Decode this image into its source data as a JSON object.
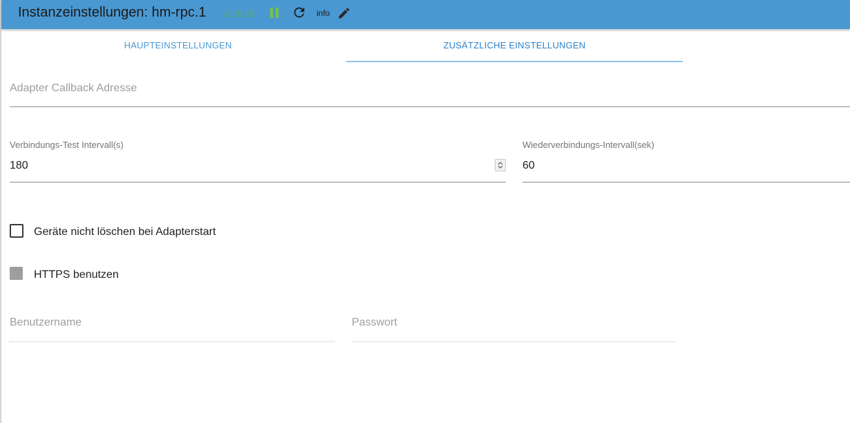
{
  "header": {
    "title": "Instanzeinstellungen: hm-rpc.1",
    "version": "v1.15.19",
    "info_label": "info",
    "colors": {
      "bar": "#4a98d2",
      "version": "#5bb34a",
      "pause": "#77c24a"
    },
    "icons": {
      "pause": "pause-icon",
      "reload": "reload-icon",
      "edit": "pencil-icon"
    }
  },
  "tabs": [
    {
      "label": "HAUPTEINSTELLUNGEN",
      "active": false
    },
    {
      "label": "ZUSÄTZLICHE EINSTELLUNGEN",
      "active": true
    }
  ],
  "fields": {
    "callback": {
      "placeholder": "Adapter Callback Adresse",
      "value": ""
    },
    "conn_test": {
      "label": "Verbindungs-Test Intervall(s)",
      "value": "180"
    },
    "reconnect": {
      "label": "Wiederverbindungs-Intervall(sek)",
      "value": "60"
    },
    "username": {
      "placeholder": "Benutzername",
      "value": ""
    },
    "password": {
      "placeholder": "Passwort",
      "value": ""
    }
  },
  "checkboxes": {
    "no_delete": {
      "label": "Geräte nicht löschen bei Adapterstart",
      "checked": false
    },
    "https": {
      "label": "HTTPS benutzen",
      "checked": false,
      "disabled": true
    }
  }
}
